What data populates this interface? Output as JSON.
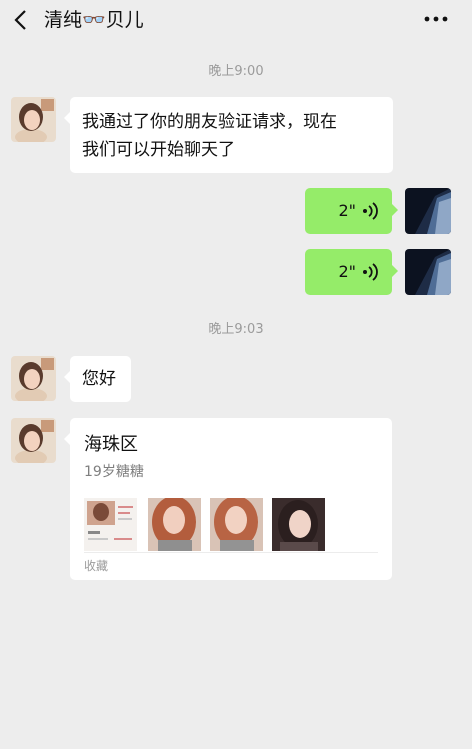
{
  "header": {
    "title": "清纯👓贝儿",
    "back_icon": "chevron-left-icon",
    "more_icon": "more-dots-icon"
  },
  "messages": {
    "time1": "晚上9:00",
    "m1_text_line1": "我通过了你的朋友验证请求，现在",
    "m1_text_line2": "我们可以开始聊天了",
    "voice1_duration": "2\"",
    "voice2_duration": "2\"",
    "time2": "晚上9:03",
    "m2_text": "您好",
    "card_title": "海珠区",
    "card_desc": "19岁糖糖",
    "card_footer": "收藏"
  },
  "colors": {
    "background": "#ededed",
    "bubble_in": "#ffffff",
    "bubble_out": "#95ec69",
    "time_text": "#9b9b9b"
  }
}
